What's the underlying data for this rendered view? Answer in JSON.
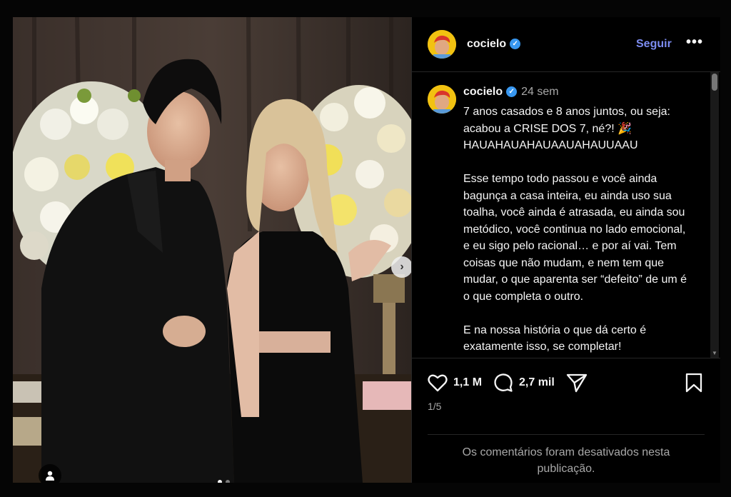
{
  "post": {
    "username": "cocielo",
    "verified_mark": "✓",
    "follow_label": "Seguir",
    "more_label": "•••",
    "time_ago": "24 sem",
    "caption_lines": [
      "7 anos casados e 8 anos juntos, ou seja: acabou a CRISE DOS 7, né?! 🎉 HAUAHAUAHAUAAUAHAUUAAU",
      "Esse tempo todo passou e você ainda bagunça a casa inteira, eu ainda uso sua toalha, você ainda é atrasada, eu ainda sou metódico, você continua no lado emocional, e eu sigo pelo racional… e por aí vai. Tem coisas que não mudam, e nem tem que mudar, o que aparenta ser “defeito” de um é o que completa o outro.",
      "E na nossa história o que dá certo é exatamente isso, se completar!"
    ],
    "likes": "1,1 M",
    "comments": "2,7 mil",
    "carousel_counter": "1/5",
    "comments_disabled": "Os comentários foram desativados nesta publicação.",
    "carousel": {
      "total": 5,
      "current": 1
    }
  },
  "icons": {
    "next": "chevron-right-icon",
    "like": "heart-icon",
    "comment": "comment-bubble-icon",
    "share": "paper-plane-icon",
    "save": "bookmark-icon",
    "tag": "user-tag-icon"
  },
  "colors": {
    "background": "#000000",
    "follow": "#7c8cf0",
    "verified": "#3897f0",
    "muted": "#a8a8a8"
  }
}
